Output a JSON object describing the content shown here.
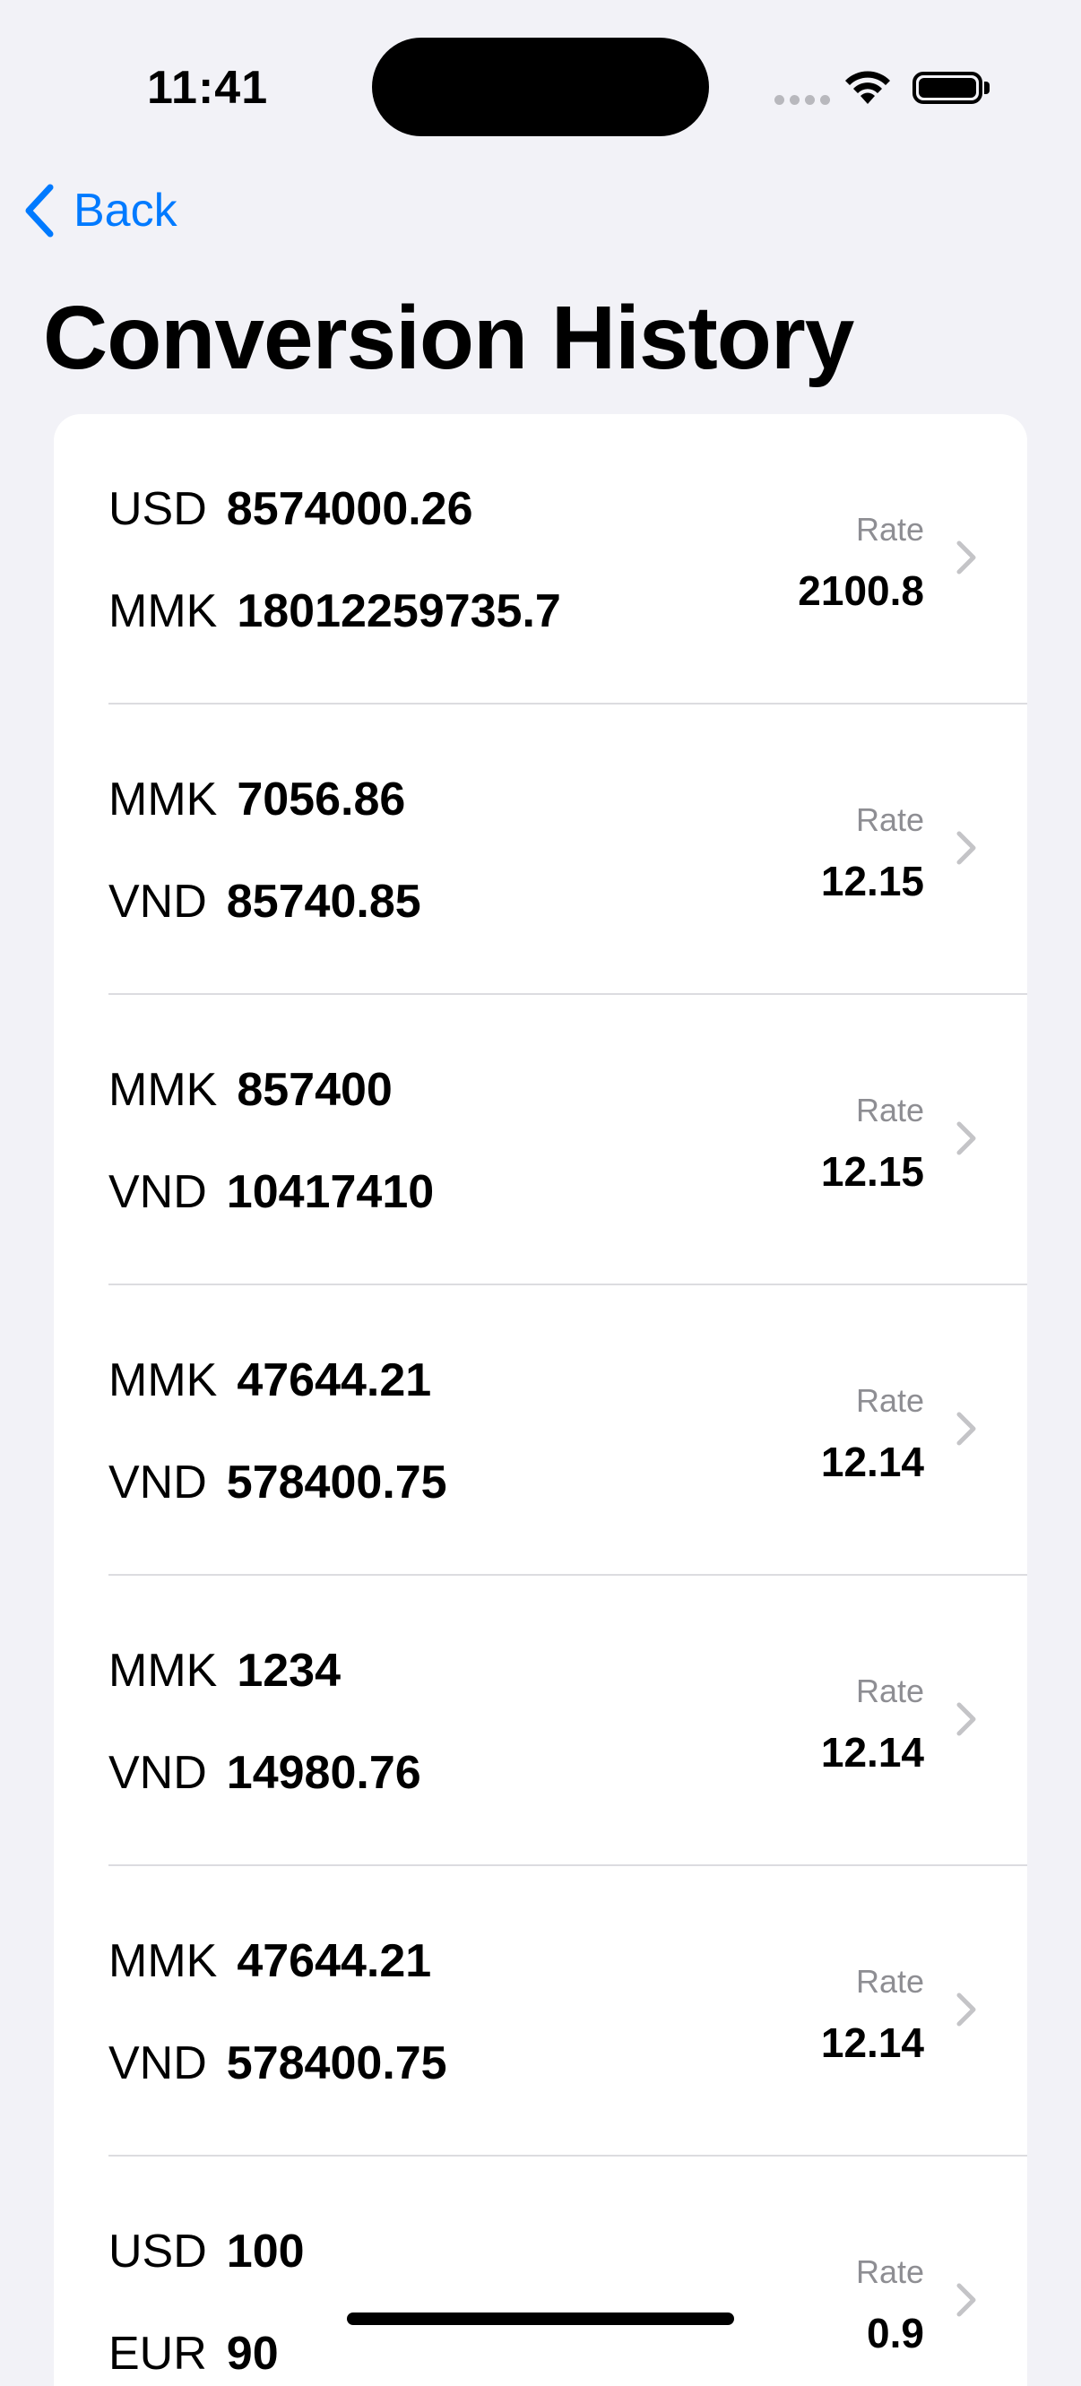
{
  "status_bar": {
    "time": "11:41"
  },
  "nav": {
    "back_label": "Back"
  },
  "page": {
    "title": "Conversion History"
  },
  "rate_label": "Rate",
  "conversions": [
    {
      "from_currency": "USD",
      "from_amount": "8574000.26",
      "to_currency": "MMK",
      "to_amount": "18012259735.7",
      "rate": "2100.8"
    },
    {
      "from_currency": "MMK",
      "from_amount": "7056.86",
      "to_currency": "VND",
      "to_amount": "85740.85",
      "rate": "12.15"
    },
    {
      "from_currency": "MMK",
      "from_amount": "857400",
      "to_currency": "VND",
      "to_amount": "10417410",
      "rate": "12.15"
    },
    {
      "from_currency": "MMK",
      "from_amount": "47644.21",
      "to_currency": "VND",
      "to_amount": "578400.75",
      "rate": "12.14"
    },
    {
      "from_currency": "MMK",
      "from_amount": "1234",
      "to_currency": "VND",
      "to_amount": "14980.76",
      "rate": "12.14"
    },
    {
      "from_currency": "MMK",
      "from_amount": "47644.21",
      "to_currency": "VND",
      "to_amount": "578400.75",
      "rate": "12.14"
    },
    {
      "from_currency": "USD",
      "from_amount": "100",
      "to_currency": "EUR",
      "to_amount": "90",
      "rate": "0.9"
    }
  ],
  "icons": {
    "wifi": "wifi-icon",
    "battery": "battery-icon",
    "back": "chevron-left-icon",
    "row_disclosure": "chevron-right-icon"
  },
  "colors": {
    "background": "#F2F2F7",
    "accent": "#007AFF",
    "secondary_text": "#8E8E93",
    "chevron": "#C4C4C7"
  }
}
